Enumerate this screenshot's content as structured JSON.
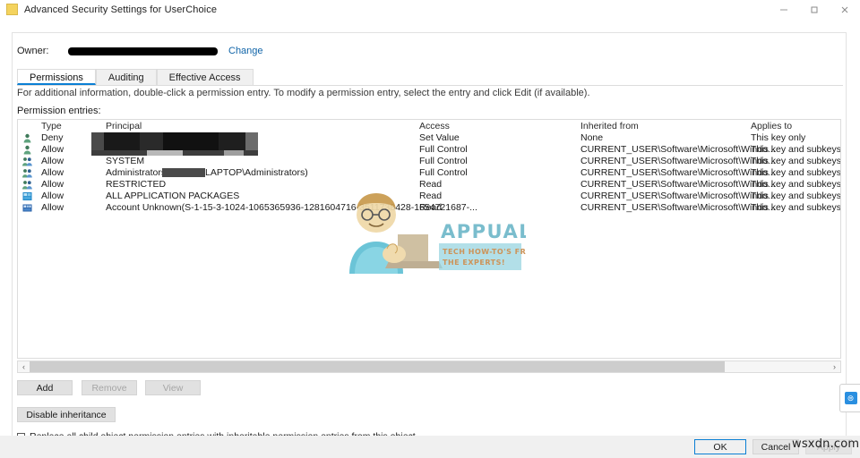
{
  "window": {
    "title": "Advanced Security Settings for UserChoice",
    "icon": "folder-icon",
    "minimize_label": "—",
    "maximize_label": "❐",
    "close_label": "✕"
  },
  "owner": {
    "label": "Owner:",
    "value": "",
    "redacted": true,
    "change_link": "Change"
  },
  "tabs": [
    {
      "label": "Permissions",
      "active": true
    },
    {
      "label": "Auditing",
      "active": false
    },
    {
      "label": "Effective Access",
      "active": false
    }
  ],
  "info_line": "For additional information, double-click a permission entry. To modify a permission entry, select the entry and click Edit (if available).",
  "entries_label": "Permission entries:",
  "table": {
    "columns": [
      "Type",
      "Principal",
      "Access",
      "Inherited from",
      "Applies to"
    ],
    "rows": [
      {
        "icon": "user-icon",
        "type": "Deny",
        "principal": "",
        "redacted": true,
        "access": "Set Value",
        "inherited_from": "None",
        "applies_to": "This key only"
      },
      {
        "icon": "user-icon",
        "type": "Allow",
        "principal": "",
        "redacted": true,
        "access": "Full Control",
        "inherited_from": "CURRENT_USER\\Software\\Microsoft\\Windo...",
        "applies_to": "This key and subkeys"
      },
      {
        "icon": "group-icon",
        "type": "Allow",
        "principal": "SYSTEM",
        "redacted": false,
        "access": "Full Control",
        "inherited_from": "CURRENT_USER\\Software\\Microsoft\\Windo...",
        "applies_to": "This key and subkeys"
      },
      {
        "icon": "group-icon",
        "type": "Allow",
        "principal": "Administrators (          LAPTOP\\Administrators)",
        "principal_prefix": "Administrators (",
        "principal_suffix": "LAPTOP\\Administrators)",
        "redacted": false,
        "inline_redaction": true,
        "access": "Full Control",
        "inherited_from": "CURRENT_USER\\Software\\Microsoft\\Windo...",
        "applies_to": "This key and subkeys"
      },
      {
        "icon": "group-icon",
        "type": "Allow",
        "principal": "RESTRICTED",
        "redacted": false,
        "access": "Read",
        "inherited_from": "CURRENT_USER\\Software\\Microsoft\\Windo...",
        "applies_to": "This key and subkeys"
      },
      {
        "icon": "package-icon",
        "type": "Allow",
        "principal": "ALL APPLICATION PACKAGES",
        "redacted": false,
        "access": "Read",
        "inherited_from": "CURRENT_USER\\Software\\Microsoft\\Windo...",
        "applies_to": "This key and subkeys"
      },
      {
        "icon": "unknown-account-icon",
        "type": "Allow",
        "principal": "Account Unknown(S-1-15-3-1024-1065365936-1281604716-3511738428-1654721687-...",
        "redacted": false,
        "access": "Read",
        "inherited_from": "CURRENT_USER\\Software\\Microsoft\\Windo...",
        "applies_to": "This key and subkeys"
      }
    ]
  },
  "scrollbar": {
    "left_arrow": "‹",
    "right_arrow": "›",
    "thumb_percent": 87
  },
  "buttons": {
    "add": {
      "label": "Add",
      "enabled": true
    },
    "remove": {
      "label": "Remove",
      "enabled": false
    },
    "view": {
      "label": "View",
      "enabled": false
    },
    "disable_inheritance": {
      "label": "Disable inheritance",
      "enabled": true
    }
  },
  "replace_checkbox": {
    "label": "Replace all child object permission entries with inheritable permission entries from this object",
    "checked": false
  },
  "footer": {
    "ok": "OK",
    "cancel": "Cancel",
    "apply": "Apply"
  },
  "watermarks": {
    "appuals_title": "APPUALS",
    "appuals_tagline_1": "TECH HOW-TO'S FROM",
    "appuals_tagline_2": "THE EXPERTS!",
    "corner": "wsxdn.com"
  },
  "side_widget": {
    "icon": "blue-app-icon",
    "glyph": "⊜"
  },
  "colors": {
    "accent": "#0a7fd4",
    "link": "#1064a8",
    "window_bg": "#ffffff",
    "dialog_bg": "#f0f0f0",
    "button_bg": "#e1e1e1",
    "border": "#dcdcdc",
    "disabled_text": "#a6a6a6",
    "redaction": "#000000"
  }
}
